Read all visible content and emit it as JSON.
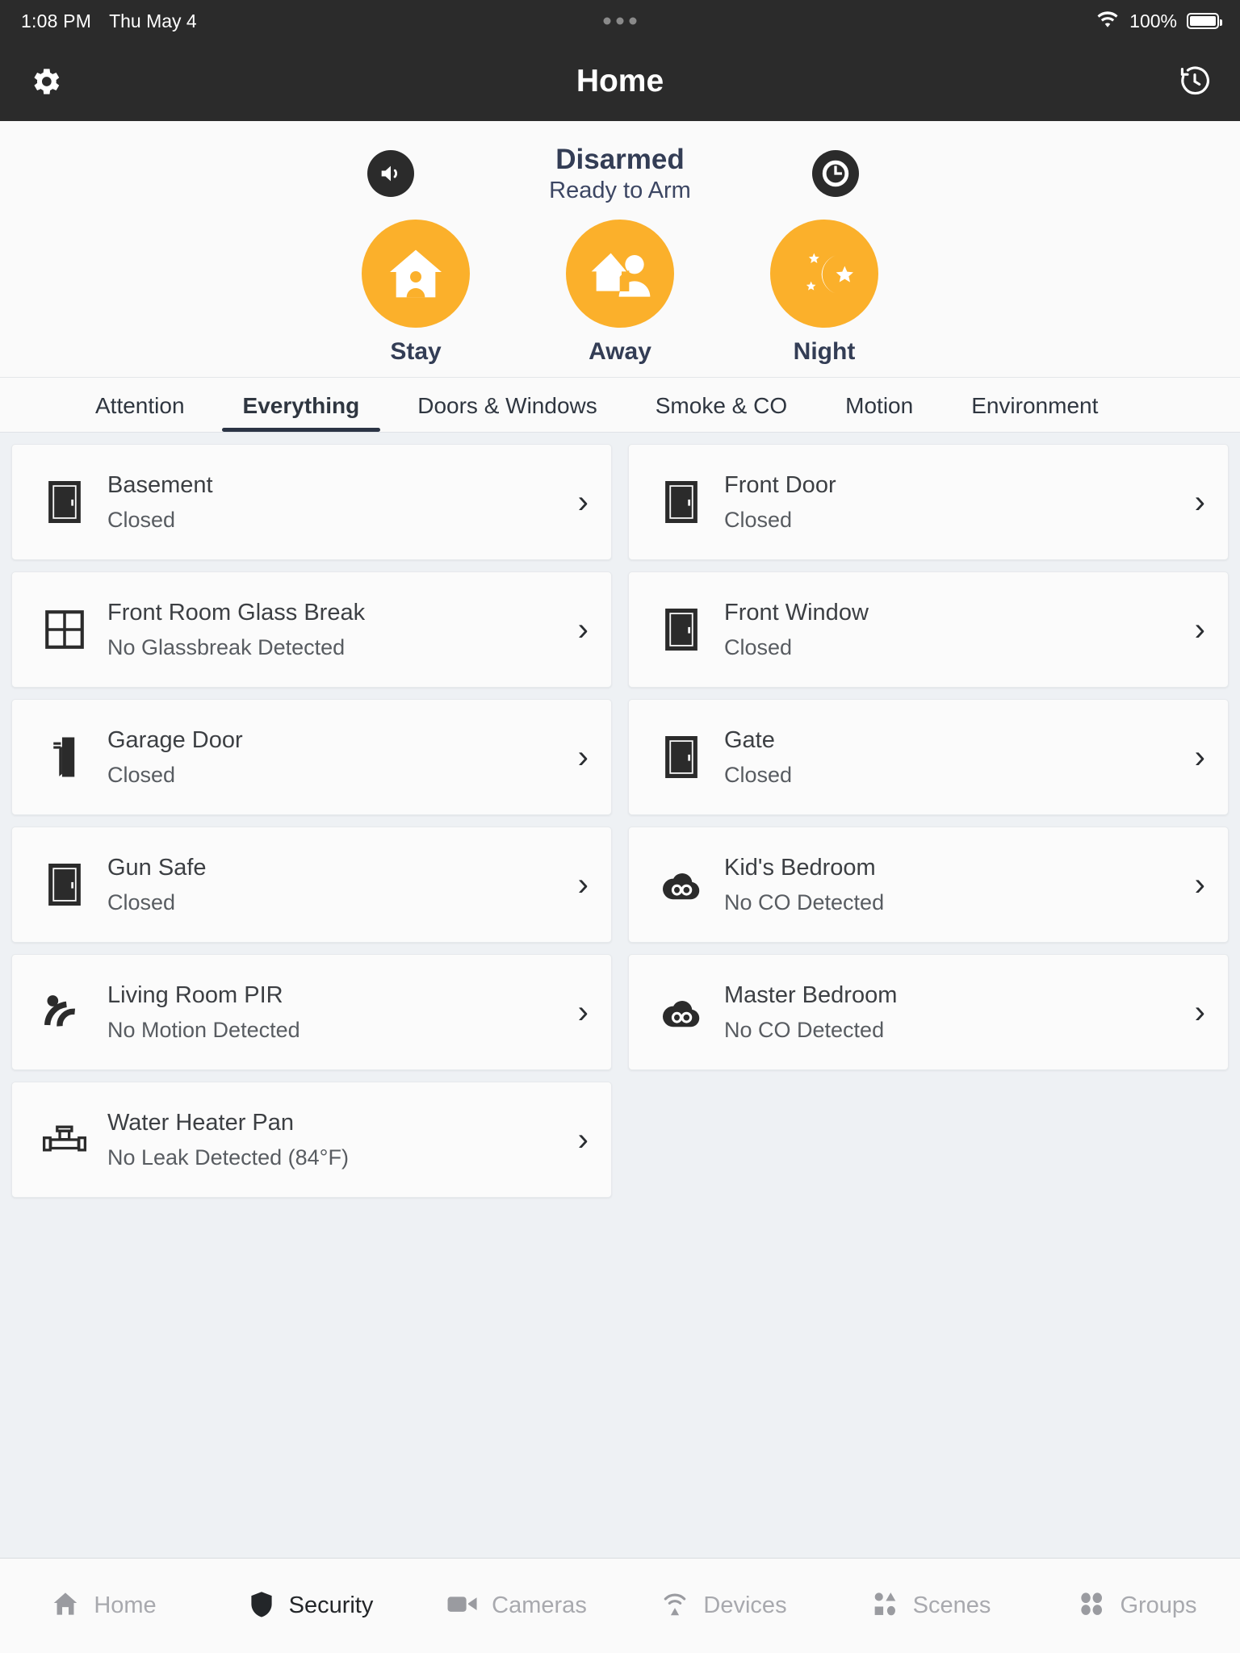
{
  "status_bar": {
    "time": "1:08 PM",
    "date": "Thu May 4",
    "battery_percent": "100%",
    "wifi_icon": "wifi-icon",
    "battery_icon": "battery-full-icon",
    "dots_icon": "recording-dots-icon"
  },
  "header": {
    "title": "Home",
    "settings_icon": "gear-icon",
    "history_icon": "history-clock-icon"
  },
  "security_panel": {
    "status_title": "Disarmed",
    "status_subtitle": "Ready to Arm",
    "chime_icon": "speaker-chime-icon",
    "clock_icon": "clock-icon",
    "accent_color": "#fbb02b",
    "status_text_color": "#333d55",
    "modes": [
      {
        "label": "Stay",
        "icon": "house-person-icon"
      },
      {
        "label": "Away",
        "icon": "house-leaving-person-icon"
      },
      {
        "label": "Night",
        "icon": "moon-stars-icon"
      }
    ]
  },
  "tabs": [
    {
      "label": "Attention",
      "active": false
    },
    {
      "label": "Everything",
      "active": true
    },
    {
      "label": "Doors & Windows",
      "active": false
    },
    {
      "label": "Smoke & CO",
      "active": false
    },
    {
      "label": "Motion",
      "active": false
    },
    {
      "label": "Environment",
      "active": false
    }
  ],
  "devices": [
    {
      "name": "Basement",
      "state": "Closed",
      "icon": "door-icon",
      "chevron": "›"
    },
    {
      "name": "Front Door",
      "state": "Closed",
      "icon": "door-icon",
      "chevron": "›"
    },
    {
      "name": "Front Room Glass Break",
      "state": "No Glassbreak Detected",
      "icon": "window-pane-icon",
      "chevron": "›"
    },
    {
      "name": "Front Window",
      "state": "Closed",
      "icon": "door-icon",
      "chevron": "›"
    },
    {
      "name": "Garage Door",
      "state": "Closed",
      "icon": "garage-door-icon",
      "chevron": "›"
    },
    {
      "name": "Gate",
      "state": "Closed",
      "icon": "door-icon",
      "chevron": "›"
    },
    {
      "name": "Gun Safe",
      "state": "Closed",
      "icon": "door-icon",
      "chevron": "›"
    },
    {
      "name": "Kid's Bedroom",
      "state": "No CO Detected",
      "icon": "co-detector-icon",
      "chevron": "›"
    },
    {
      "name": "Living Room PIR",
      "state": "No Motion Detected",
      "icon": "motion-pir-icon",
      "chevron": "›"
    },
    {
      "name": "Master Bedroom",
      "state": "No CO Detected",
      "icon": "co-detector-icon",
      "chevron": "›"
    },
    {
      "name": "Water Heater Pan",
      "state": "No Leak Detected (84°F)",
      "icon": "water-leak-icon",
      "chevron": "›"
    }
  ],
  "bottom_nav": [
    {
      "label": "Home",
      "icon": "home-icon",
      "active": false
    },
    {
      "label": "Security",
      "icon": "shield-icon",
      "active": true
    },
    {
      "label": "Cameras",
      "icon": "camera-icon",
      "active": false
    },
    {
      "label": "Devices",
      "icon": "devices-signal-icon",
      "active": false
    },
    {
      "label": "Scenes",
      "icon": "scenes-shapes-icon",
      "active": false
    },
    {
      "label": "Groups",
      "icon": "groups-dots-icon",
      "active": false
    }
  ]
}
